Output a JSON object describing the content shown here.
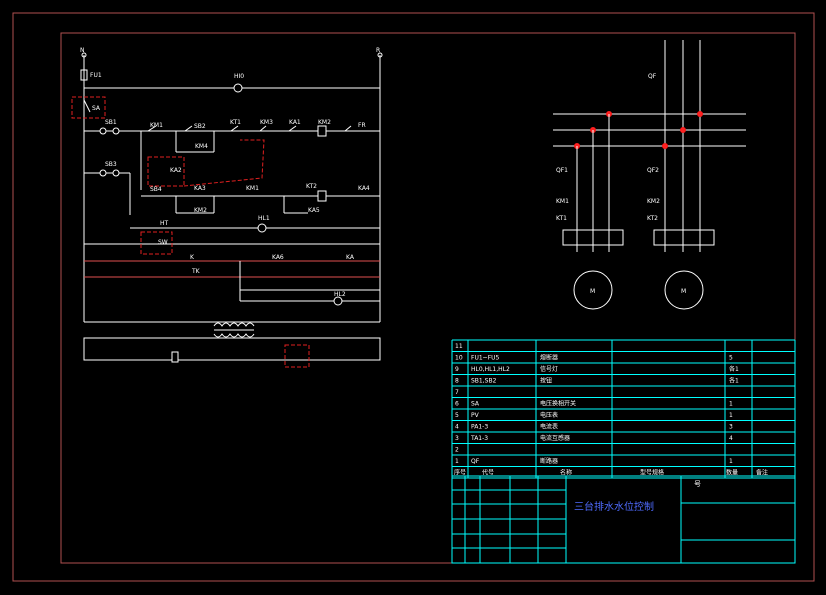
{
  "colors": {
    "background": "#000000",
    "border": "#b05050",
    "wire": "#ffffff",
    "table": "#00ffff",
    "highlight": "#e02020",
    "node": "#ff2020",
    "title": "#4f6bff"
  },
  "control": {
    "top_left": "N",
    "top_right": "R",
    "fuse": "FU1",
    "sa": "SA",
    "hl_top": "HI0",
    "sb1": "SB1",
    "sb2": "SB2",
    "sb3": "SB3",
    "sb4": "SB4",
    "km1": "KM1",
    "km2": "KM2",
    "km3": "KM3",
    "km4": "KM4",
    "kt1": "KT1",
    "kt2": "KT2",
    "ka1": "KA1",
    "ka2": "KA2",
    "ka3": "KA3",
    "ka4": "KA4",
    "ka5": "KA5",
    "hl1": "HL1",
    "hl2": "HL2",
    "fr": "FR",
    "sw": "SW",
    "km1b": "KM1",
    "km2b": "KM2",
    "ht": "HT",
    "k": "K",
    "tk": "TK",
    "ka6": "KA6",
    "ka": "KA"
  },
  "power": {
    "qf": "QF",
    "qf1": "QF1",
    "qf2": "QF2",
    "km1": "KM1",
    "km2": "KM2",
    "kt1": "KT1",
    "kt2": "KT2",
    "m1": "M",
    "m2": "M"
  },
  "parts_table": {
    "rows": [
      {
        "no": "11",
        "code": "",
        "name": "",
        "qty": ""
      },
      {
        "no": "10",
        "code": "FU1~FU5",
        "name": "熔断器",
        "qty": "5"
      },
      {
        "no": "9",
        "code": "HL0,HL1,HL2",
        "name": "信号灯",
        "qty": "各1"
      },
      {
        "no": "8",
        "code": "SB1,SB2",
        "name": "按钮",
        "qty": "各1"
      },
      {
        "no": "7",
        "code": "",
        "name": "",
        "qty": ""
      },
      {
        "no": "6",
        "code": "SA",
        "name": "电压换相开关",
        "qty": "1"
      },
      {
        "no": "5",
        "code": "PV",
        "name": "电压表",
        "qty": "1"
      },
      {
        "no": "4",
        "code": "PA1-3",
        "name": "电流表",
        "qty": "3"
      },
      {
        "no": "3",
        "code": "TA1-3",
        "name": "电流互感器",
        "qty": "4"
      },
      {
        "no": "2",
        "code": "",
        "name": "",
        "qty": ""
      },
      {
        "no": "1",
        "code": "QF",
        "name": "断路器",
        "qty": "1"
      }
    ],
    "header": {
      "no": "序号",
      "code": "代号",
      "name": "名称",
      "spec": "型号规格",
      "qty": "数量",
      "note": "备注"
    }
  },
  "title_block": {
    "title": "三台排水水位控制",
    "number_label": "号"
  }
}
